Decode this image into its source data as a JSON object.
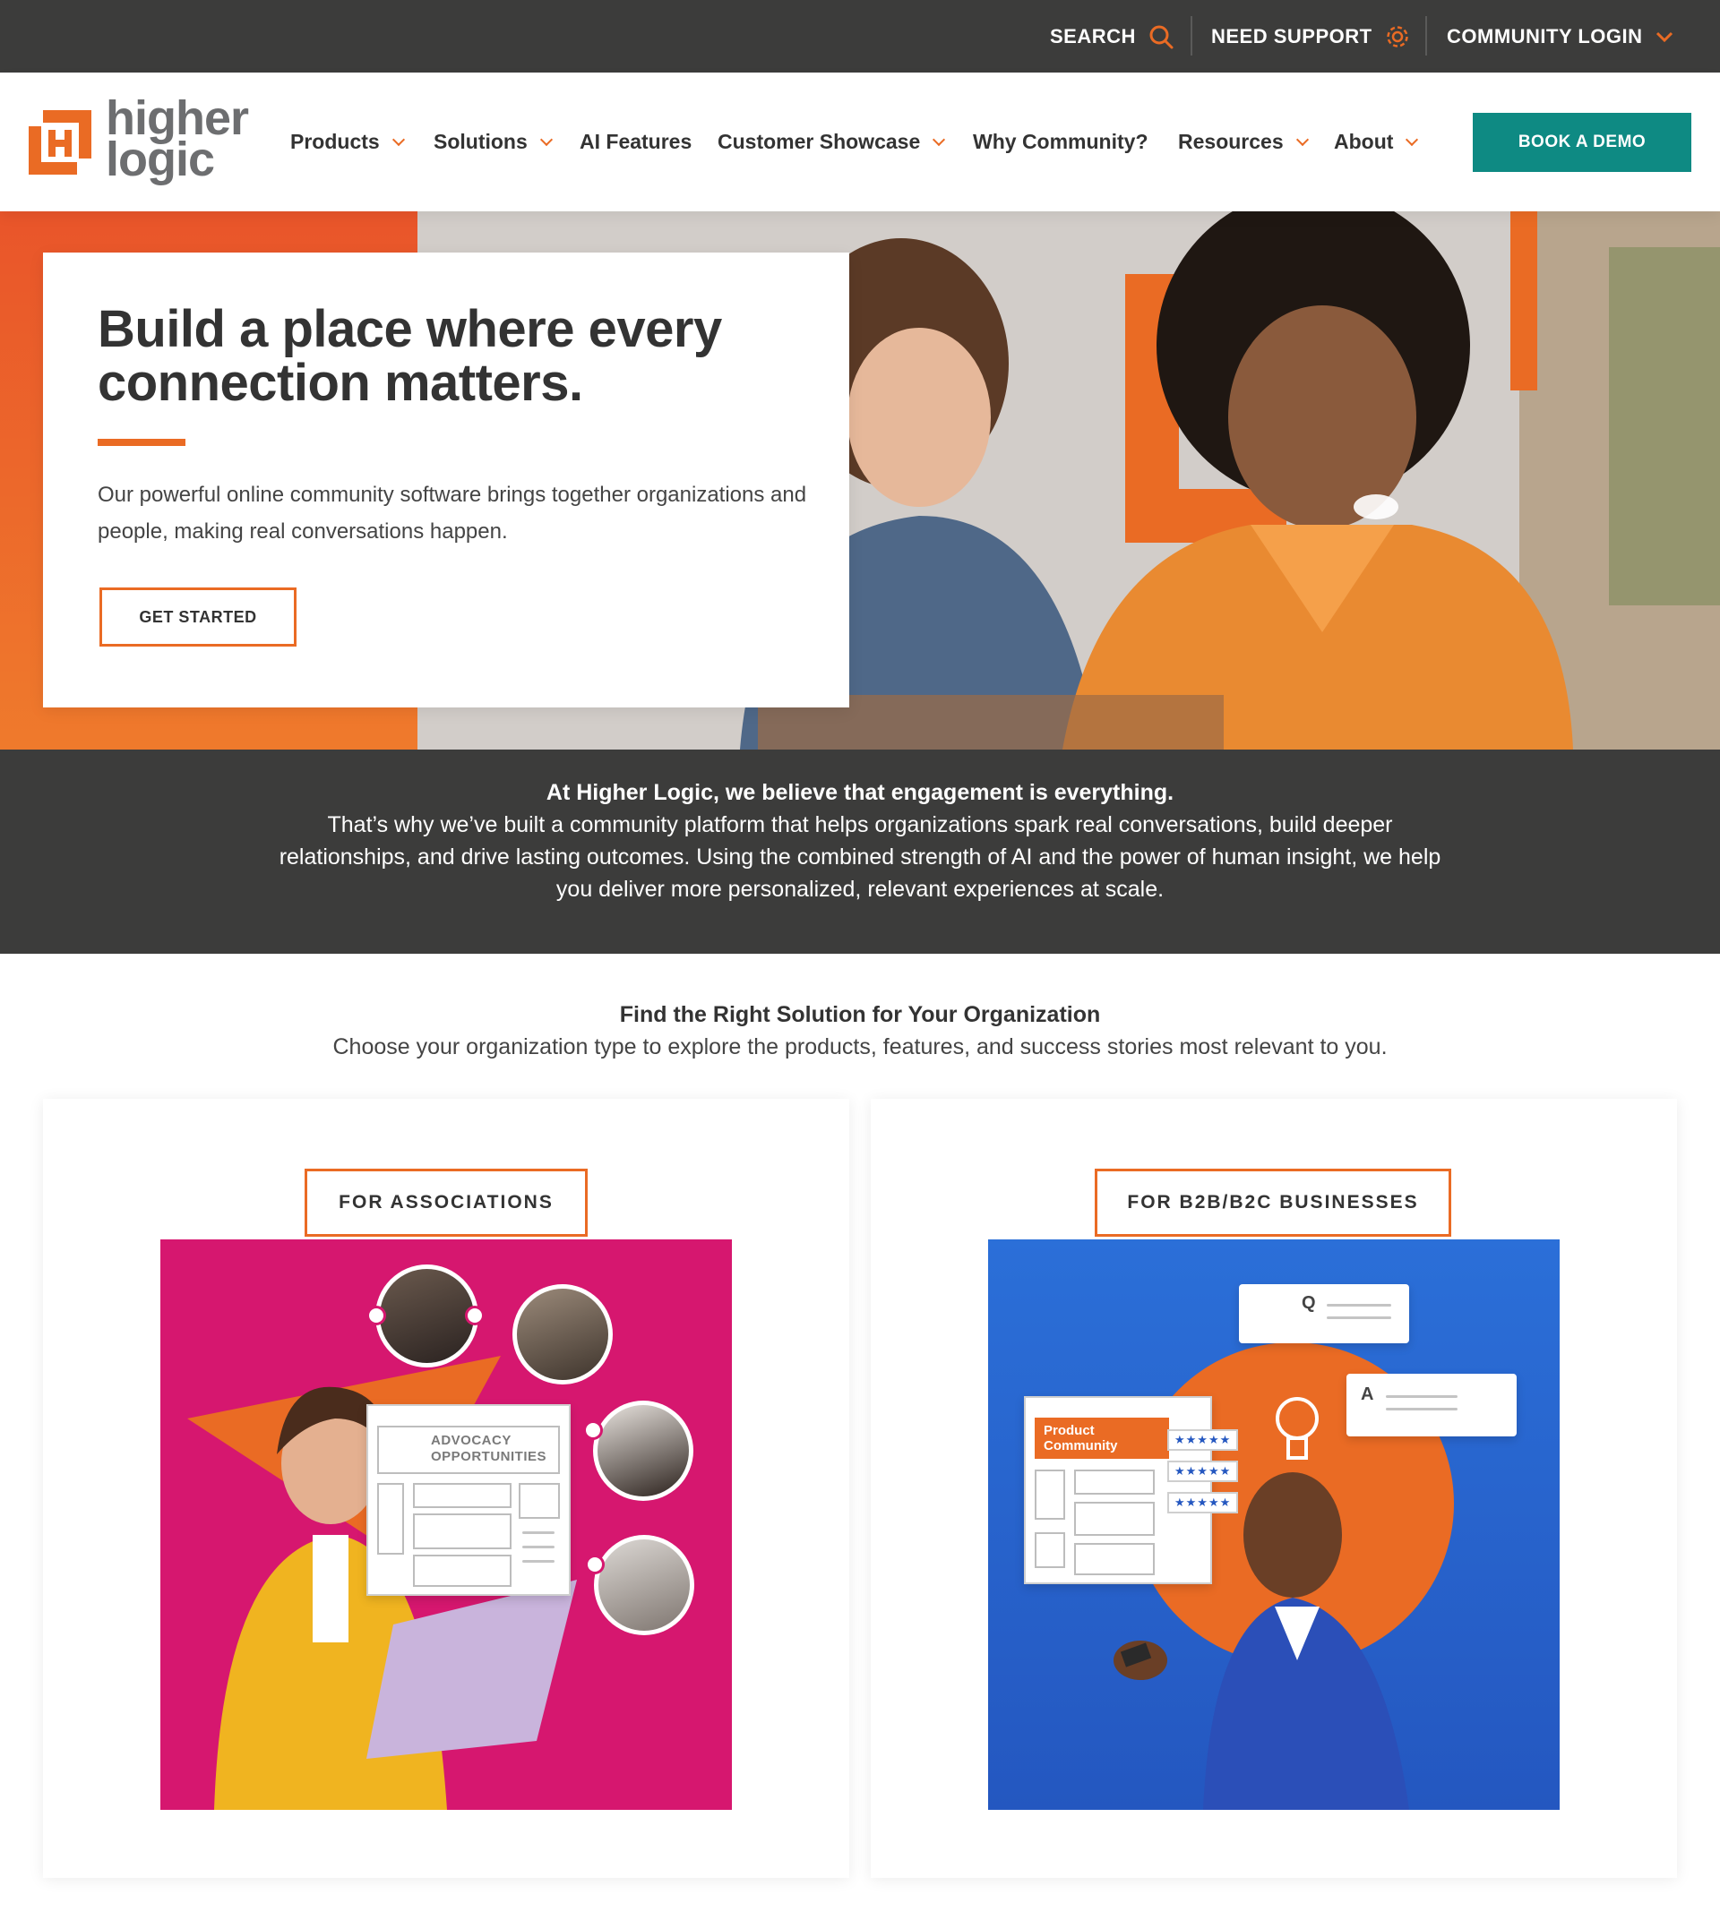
{
  "utility": {
    "search": "SEARCH",
    "support": "NEED SUPPORT",
    "login": "COMMUNITY LOGIN"
  },
  "brand": {
    "name_line1": "higher",
    "name_line2": "logic",
    "orange": "#ea6b24",
    "teal": "#0e8a83",
    "dark": "#3c3c3b"
  },
  "nav": {
    "items": [
      {
        "label": "Products",
        "dropdown": true
      },
      {
        "label": "Solutions",
        "dropdown": true
      },
      {
        "label": "AI Features",
        "dropdown": false
      },
      {
        "label": "Customer Showcase",
        "dropdown": true
      },
      {
        "label": "Why Community?",
        "dropdown": false
      },
      {
        "label": "Resources",
        "dropdown": true
      },
      {
        "label": "About",
        "dropdown": true
      }
    ],
    "cta": "BOOK A DEMO"
  },
  "hero": {
    "title_line1": "Build a place where every",
    "title_bold": "connection",
    "title_rest": " matters.",
    "subtitle": "Our powerful online community software brings together organizations and people, making real conversations happen.",
    "cta": "GET STARTED"
  },
  "statement": {
    "lead": "At Higher Logic, we believe that engagement is everything.",
    "body": "That’s why we’ve built a community platform that helps organizations spark real conversations, build deeper relationships, and drive lasting outcomes. Using the combined strength of AI and the power of human insight, we help you deliver more personalized, relevant experiences at scale."
  },
  "solutions": {
    "title": "Find the Right Solution for Your Organization",
    "subtitle": "Choose your organization type to explore the products, features, and success stories most relevant to you.",
    "cards": [
      {
        "label": "FOR ASSOCIATIONS",
        "art_label": "ADVOCACY OPPORTUNITIES",
        "color": "#d6176f"
      },
      {
        "label": "FOR B2B/B2C BUSINESSES",
        "art_label": "Product Community",
        "color": "#2563c9",
        "q": "Q",
        "a": "A"
      }
    ]
  }
}
